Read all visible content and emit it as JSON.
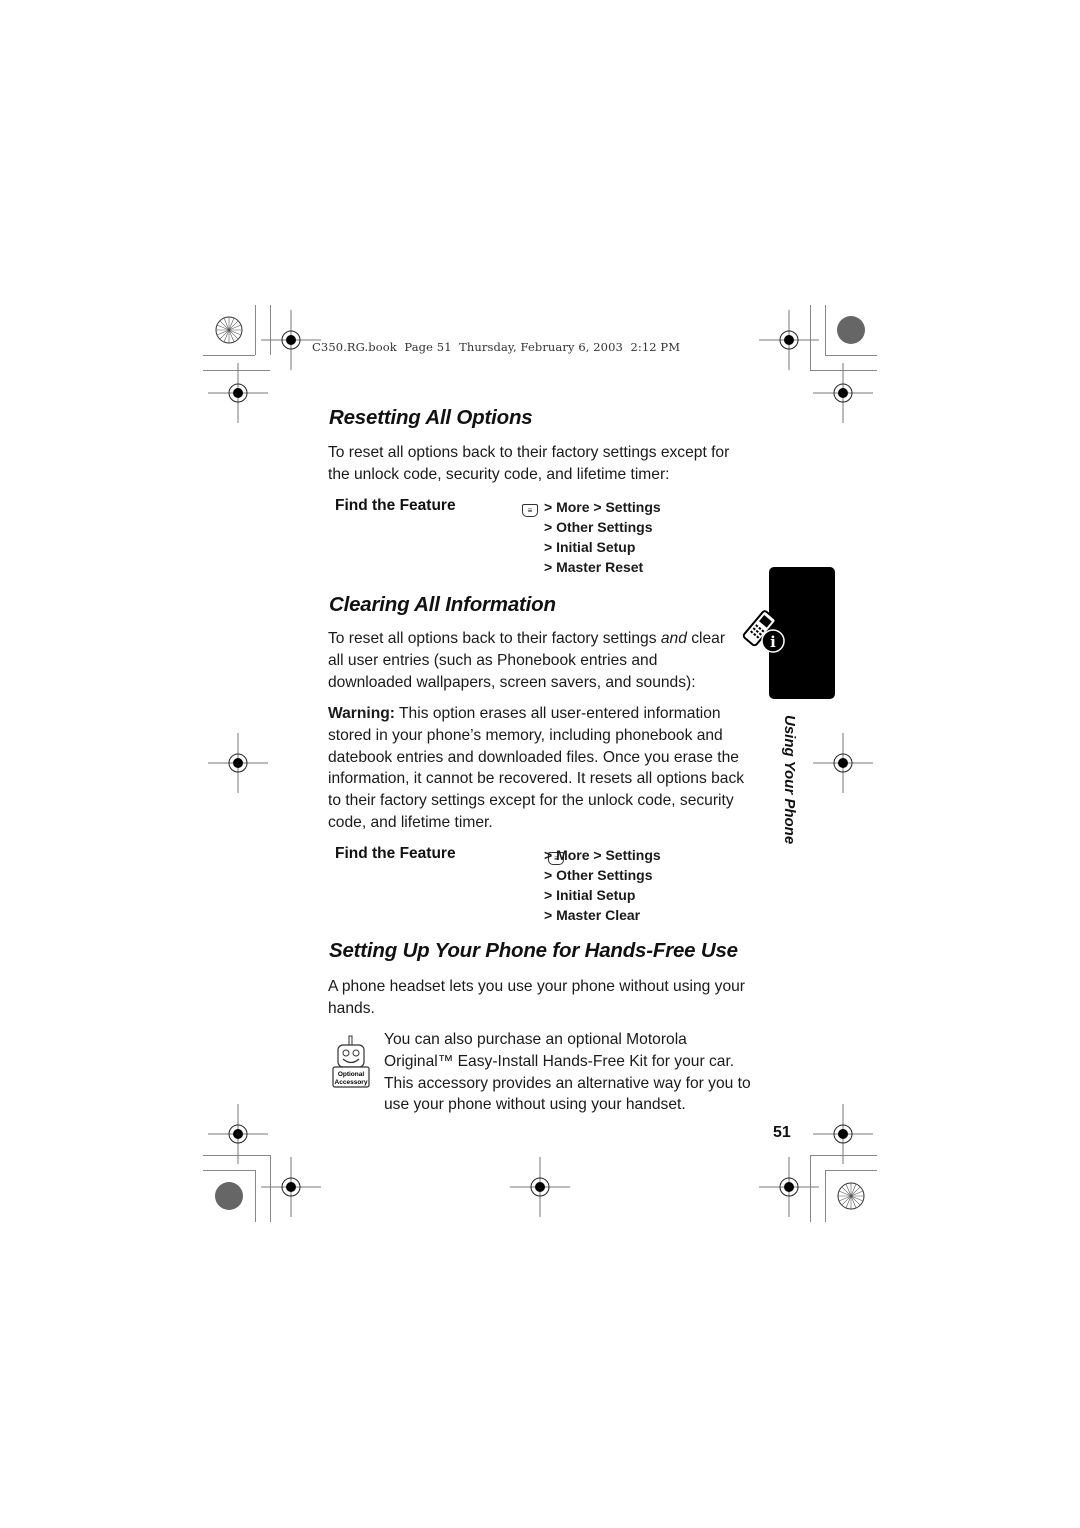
{
  "header": {
    "running_line": "C350.RG.book  Page 51  Thursday, February 6, 2003  2:12 PM"
  },
  "sections": [
    {
      "title": "Resetting All Options",
      "body": "To reset all options back to their factory settings except for the unlock code, security code, and lifetime timer:",
      "find_feature": {
        "label": "Find the Feature",
        "menu_icon": "menu-key-icon",
        "path": [
          "> More > Settings",
          "> Other Settings",
          "> Initial Setup",
          "> Master Reset"
        ]
      }
    },
    {
      "title": "Clearing All Information",
      "body_pre": "To reset all options back to their factory settings ",
      "body_em": "and",
      "body_post": " clear all user entries (such as Phonebook entries and downloaded wallpapers, screen savers, and sounds):",
      "warning_label": "Warning:",
      "warning_text": " This option erases all user-entered information stored in your phone’s memory, including phonebook and datebook entries and downloaded files. Once you erase the information, it cannot be recovered. It resets all options back to their factory settings except for the unlock code, security code, and lifetime timer.",
      "find_feature": {
        "label": "Find the Feature",
        "menu_icon": "menu-key-icon",
        "path": [
          "> More > Settings",
          "> Other Settings",
          "> Initial Setup",
          "> Master Clear"
        ]
      }
    },
    {
      "title": "Setting Up Your Phone for Hands-Free Use",
      "body": "A phone headset lets you use your phone without using your hands.",
      "accessory_note": "You can also purchase an optional Motorola Original™ Easy-Install Hands-Free Kit for your car. This accessory provides an alternative way for you to use your phone without using your handset.",
      "accessory_icon_label_1": "Optional",
      "accessory_icon_label_2": "Accessory"
    }
  ],
  "side_tab": {
    "icon": "phone-info-icon",
    "label": "Using Your Phone"
  },
  "page_number": "51"
}
